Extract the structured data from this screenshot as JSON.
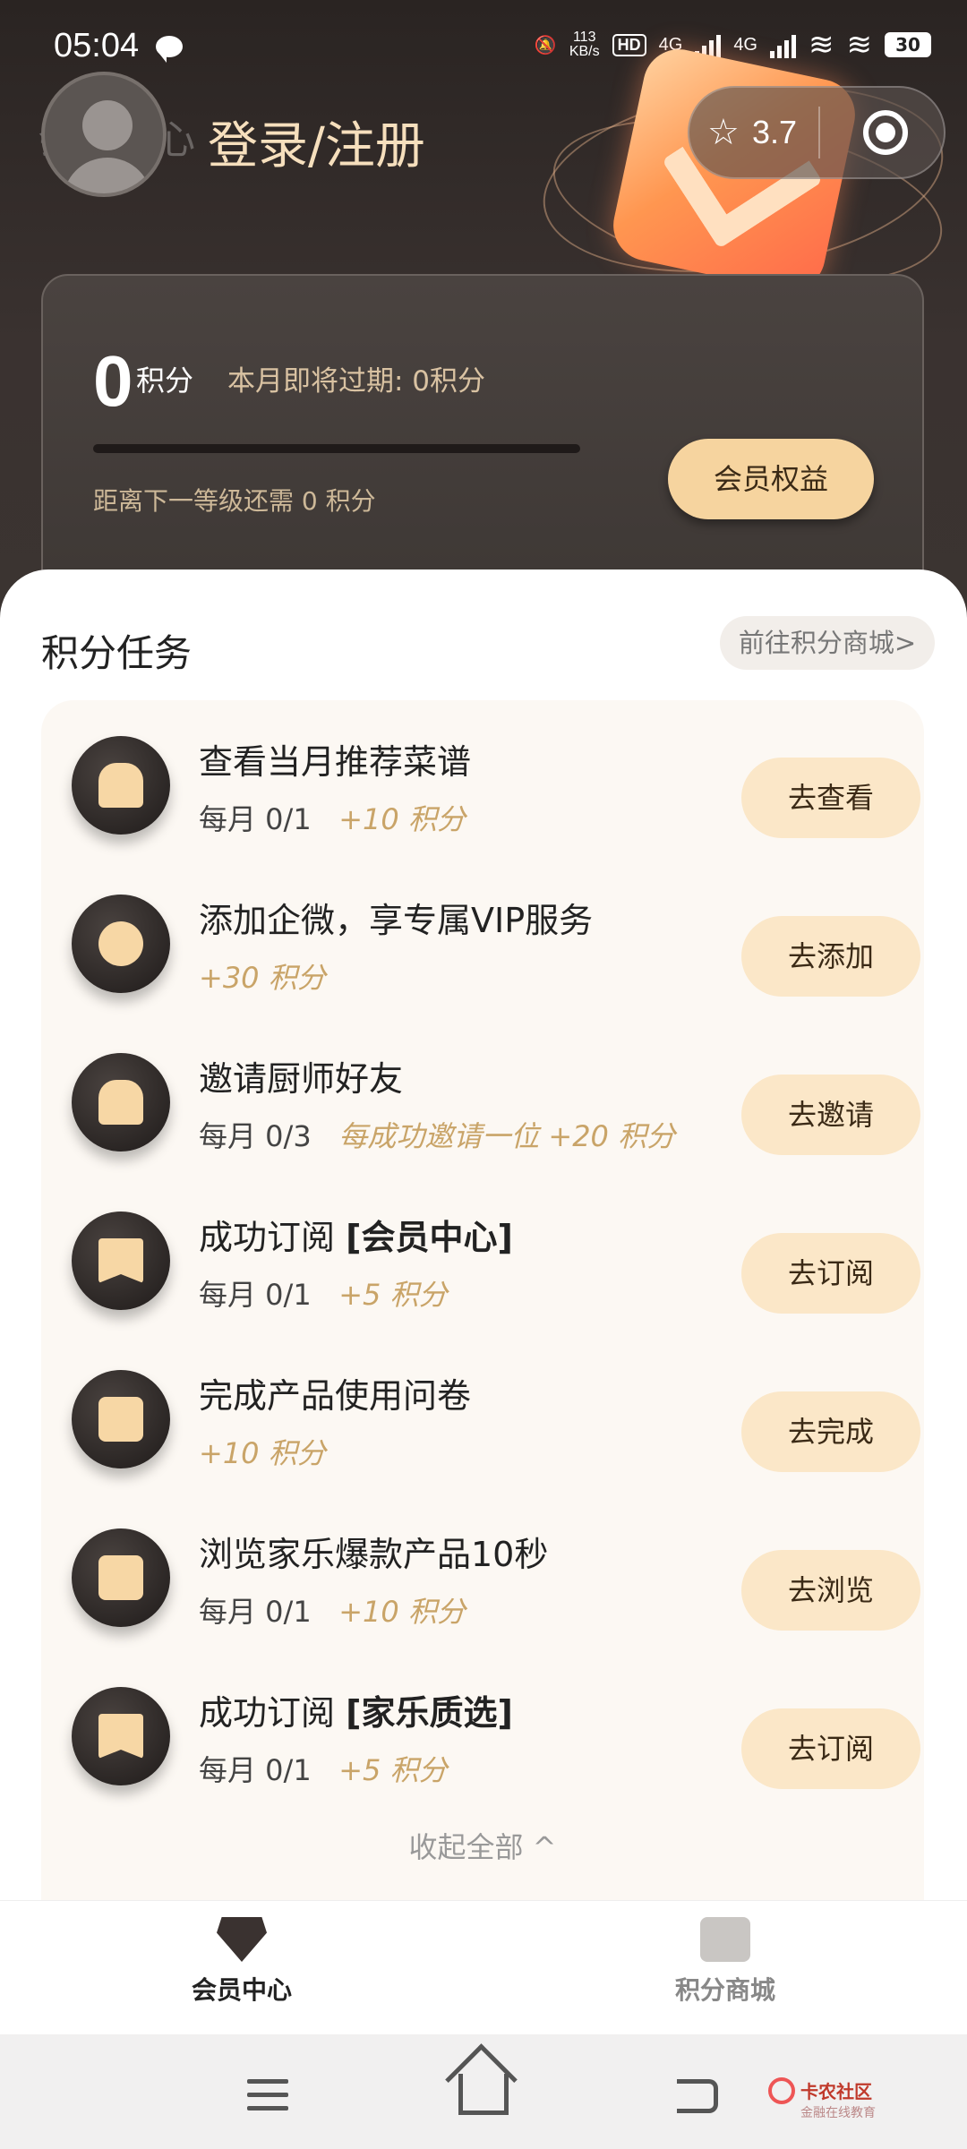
{
  "status_bar": {
    "time": "05:04",
    "net_speed": "113\nKB/s",
    "hd": "HD",
    "net1": "4G",
    "net2": "4G",
    "battery": "30"
  },
  "header": {
    "ghost_title": "会员中心",
    "login": "登录/注册",
    "rating": "3.7"
  },
  "points_card": {
    "points": "0",
    "unit": "积分",
    "expire_text": "本月即将过期: 0积分",
    "next_level_text": "距离下一等级还需 0 积分",
    "progress": 0,
    "benefit_button": "会员权益"
  },
  "tasks_section": {
    "title": "积分任务",
    "mall_link": "前往积分商城>",
    "collapse_label": "收起全部 ^",
    "tasks": [
      {
        "name": "查看当月推荐菜谱",
        "name_bold": "",
        "progress": "每月 0/1",
        "reward": "+10 积分",
        "button": "去查看",
        "icon": "chef-hat-icon"
      },
      {
        "name": "添加企微，享专属VIP服务",
        "name_bold": "",
        "progress": "",
        "reward": "+30 积分",
        "button": "去添加",
        "icon": "wechat-work-icon"
      },
      {
        "name": "邀请厨师好友",
        "name_bold": "",
        "progress": "每月 0/3",
        "reward": "每成功邀请一位 +20 积分",
        "button": "去邀请",
        "icon": "chef-hat-icon"
      },
      {
        "name": "成功订阅 ",
        "name_bold": "[会员中心]",
        "progress": "每月 0/1",
        "reward": "+5 积分",
        "button": "去订阅",
        "icon": "bookmark-plus-icon"
      },
      {
        "name": "完成产品使用问卷",
        "name_bold": "",
        "progress": "",
        "reward": "+10 积分",
        "button": "去完成",
        "icon": "survey-edit-icon"
      },
      {
        "name": "浏览家乐爆款产品10秒",
        "name_bold": "",
        "progress": "每月 0/1",
        "reward": "+10 积分",
        "button": "去浏览",
        "icon": "recipe-book-icon"
      },
      {
        "name": "成功订阅 ",
        "name_bold": "[家乐质选]",
        "progress": "每月 0/1",
        "reward": "+5 积分",
        "button": "去订阅",
        "icon": "bookmark-plus-icon"
      }
    ]
  },
  "tabbar": {
    "member": "会员中心",
    "mall": "积分商城"
  },
  "watermark": {
    "line1": "卡农社区",
    "line2": "金融在线教育"
  },
  "colors": {
    "accent_gold": "#f6d49f",
    "reward_gold": "#c9a468",
    "header_dark": "#2a2422"
  }
}
